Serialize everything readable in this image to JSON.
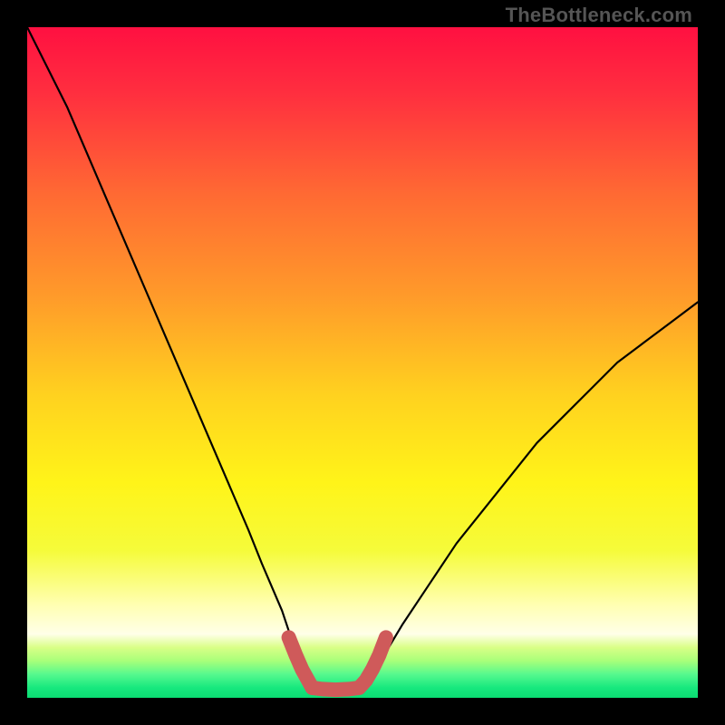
{
  "watermark": "TheBottleneck.com",
  "chart_data": {
    "type": "line",
    "title": "",
    "xlabel": "",
    "ylabel": "",
    "xlim": [
      0,
      100
    ],
    "ylim": [
      0,
      100
    ],
    "grid": false,
    "legend": false,
    "series": [
      {
        "name": "bottleneck-left",
        "x": [
          0,
          3,
          6,
          9,
          12,
          15,
          18,
          21,
          24,
          27,
          30,
          33,
          35,
          38,
          40,
          41,
          42,
          42.5
        ],
        "y": [
          100,
          94,
          88,
          81,
          74,
          67,
          60,
          53,
          46,
          39,
          32,
          25,
          20,
          13,
          7,
          4,
          2,
          1.5
        ],
        "style": "thin-black"
      },
      {
        "name": "bottleneck-flat",
        "x": [
          42.5,
          44,
          46,
          48,
          49.5
        ],
        "y": [
          1.5,
          1.3,
          1.2,
          1.3,
          1.5
        ],
        "style": "thin-black"
      },
      {
        "name": "bottleneck-right",
        "x": [
          49.5,
          51,
          53,
          56,
          60,
          64,
          68,
          72,
          76,
          80,
          84,
          88,
          92,
          96,
          100
        ],
        "y": [
          1.5,
          3,
          6,
          11,
          17,
          23,
          28,
          33,
          38,
          42,
          46,
          50,
          53,
          56,
          59
        ],
        "style": "thin-black"
      },
      {
        "name": "highlight-left-arm",
        "x": [
          39,
          40,
          41,
          42,
          42.5
        ],
        "y": [
          9,
          6.5,
          4.2,
          2.4,
          1.5
        ],
        "style": "thick-red"
      },
      {
        "name": "highlight-flat",
        "x": [
          42.5,
          44,
          46,
          48,
          49.5
        ],
        "y": [
          1.5,
          1.3,
          1.2,
          1.3,
          1.5
        ],
        "style": "thick-red"
      },
      {
        "name": "highlight-right-arm",
        "x": [
          49.5,
          50.5,
          51.5,
          52.5,
          53.5
        ],
        "y": [
          1.5,
          2.6,
          4.3,
          6.4,
          9
        ],
        "style": "thick-red"
      }
    ],
    "background_gradient": {
      "type": "vertical",
      "stops": [
        {
          "pos": 0.0,
          "color": "#ff1041"
        },
        {
          "pos": 0.1,
          "color": "#ff2f3f"
        },
        {
          "pos": 0.25,
          "color": "#ff6a33"
        },
        {
          "pos": 0.4,
          "color": "#ff9a2a"
        },
        {
          "pos": 0.55,
          "color": "#ffd21f"
        },
        {
          "pos": 0.68,
          "color": "#fff419"
        },
        {
          "pos": 0.78,
          "color": "#f5fb3a"
        },
        {
          "pos": 0.86,
          "color": "#ffffb0"
        },
        {
          "pos": 0.905,
          "color": "#ffffe8"
        },
        {
          "pos": 0.925,
          "color": "#d9ff86"
        },
        {
          "pos": 0.945,
          "color": "#a8ff7a"
        },
        {
          "pos": 0.965,
          "color": "#56f98e"
        },
        {
          "pos": 0.985,
          "color": "#17e87e"
        },
        {
          "pos": 1.0,
          "color": "#0bdc72"
        }
      ]
    },
    "styles": {
      "thin-black": {
        "stroke": "#000000",
        "width": 2.2,
        "linecap": "round"
      },
      "thick-red": {
        "stroke": "#cf5a5a",
        "width": 16,
        "linecap": "round"
      }
    }
  }
}
